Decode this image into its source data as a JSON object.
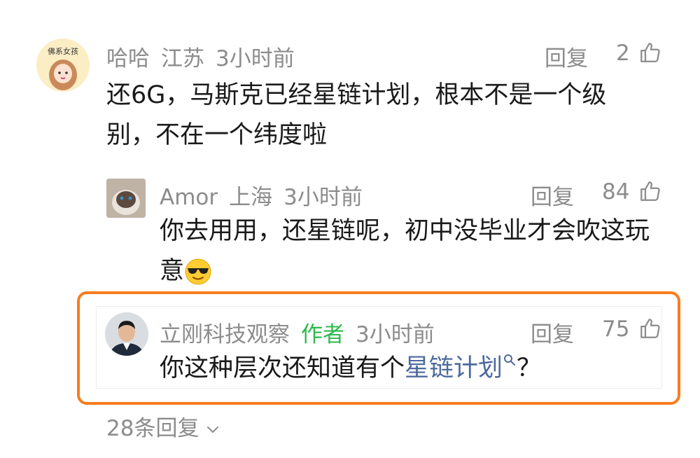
{
  "comments": [
    {
      "username": "哈哈",
      "location": "江苏",
      "time": "3小时前",
      "reply_label": "回复",
      "likes": "2",
      "avatar_text": "佛系女孩",
      "content": "还6G，马斯克已经星链计划，根本不是一个级别，不在一个纬度啦"
    },
    {
      "username": "Amor",
      "location": "上海",
      "time": "3小时前",
      "reply_label": "回复",
      "likes": "84",
      "content": "你去用用，还星链呢，初中没毕业才会吹这玩意"
    },
    {
      "username": "立刚科技观察",
      "author_tag": "作者",
      "time": "3小时前",
      "reply_label": "回复",
      "likes": "75",
      "content_prefix": "你这种层次还知道有个",
      "content_link": "星链计划",
      "content_suffix": "？"
    }
  ],
  "more_replies": "28条回复",
  "colors": {
    "highlight_border": "#f97c1e",
    "author_tag": "#2db84d",
    "link": "#4d6a9e",
    "meta_text": "#8c8c8c"
  },
  "icons": [
    "like-icon",
    "search-icon",
    "chevron-down-icon",
    "sunglasses-emoji"
  ]
}
